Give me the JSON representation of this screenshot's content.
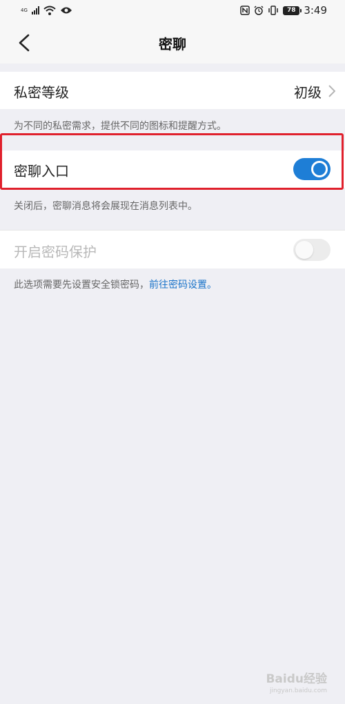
{
  "status_bar": {
    "net_type": "4G",
    "time": "3:49",
    "battery": "78"
  },
  "header": {
    "title": "密聊"
  },
  "privacy_level": {
    "label": "私密等级",
    "value": "初级",
    "hint": "为不同的私密需求，提供不同的图标和提醒方式。"
  },
  "secret_chat_entry": {
    "label": "密聊入口",
    "enabled": true,
    "hint": "关闭后，密聊消息将会展现在消息列表中。"
  },
  "password_protect": {
    "label": "开启密码保护",
    "enabled": false,
    "hint": "此选项需要先设置安全锁密码，",
    "link": "前往密码设置。"
  },
  "watermark": {
    "brand": "Baidu经验",
    "url": "jingyan.baidu.com"
  },
  "colors": {
    "accent": "#1e7ed6",
    "highlight": "#e0202c",
    "link": "#1a73c9"
  }
}
